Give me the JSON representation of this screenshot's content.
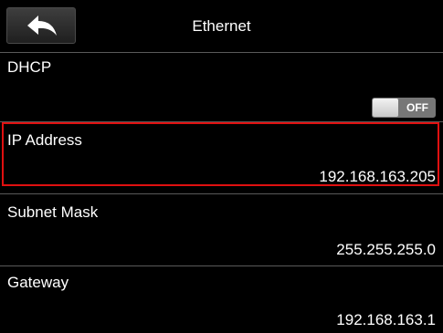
{
  "header": {
    "title": "Ethernet",
    "back_icon": "back-arrow-icon"
  },
  "rows": [
    {
      "label": "DHCP",
      "toggle": "OFF"
    },
    {
      "label": "IP Address",
      "value": "192.168.163.205",
      "selected": true
    },
    {
      "label": "Subnet Mask",
      "value": "255.255.255.0"
    },
    {
      "label": "Gateway",
      "value": "192.168.163.1"
    }
  ],
  "colors": {
    "background": "#000000",
    "text": "#ffffff",
    "divider": "#5a5a5a",
    "selection_border": "#e01010",
    "toggle_off": "#777777"
  }
}
